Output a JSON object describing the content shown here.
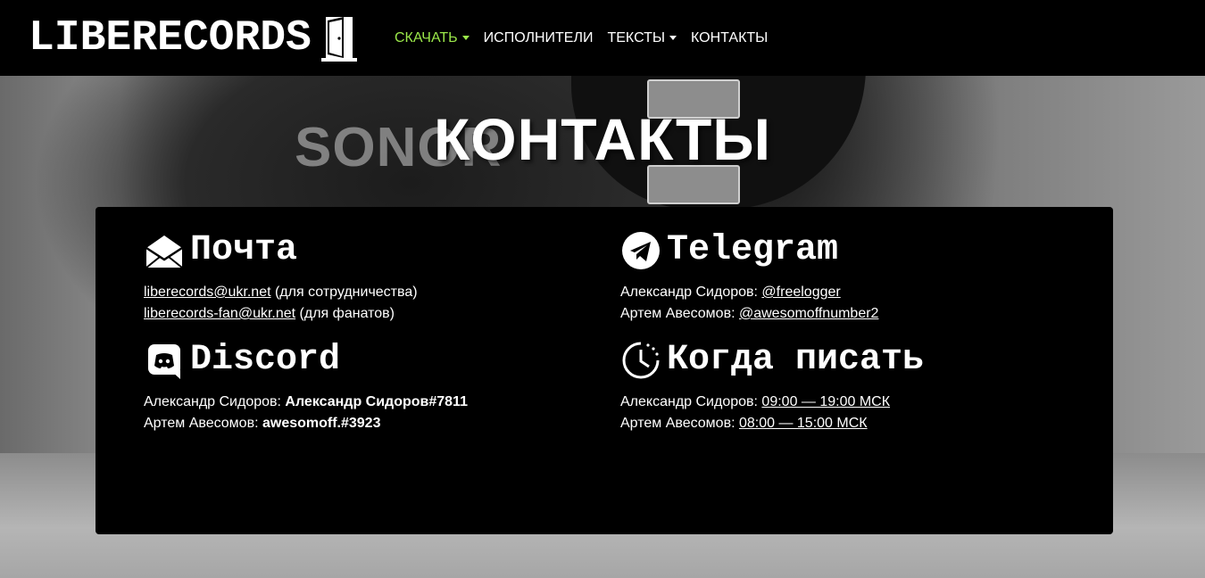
{
  "brand": {
    "logo_text": "LIBERECORDS"
  },
  "nav": {
    "items": [
      {
        "label": "СКАЧАТЬ",
        "active": true,
        "dropdown": true
      },
      {
        "label": "ИСПОЛНИТЕЛИ",
        "active": false,
        "dropdown": false
      },
      {
        "label": "ТЕКСТЫ",
        "active": false,
        "dropdown": true
      },
      {
        "label": "КОНТАКТЫ",
        "active": false,
        "dropdown": false
      }
    ]
  },
  "hero": {
    "title": "КОНТАКТЫ",
    "background_text": "SONOR"
  },
  "colors": {
    "accent": "#9be84a",
    "panel": "#000000",
    "text": "#ffffff"
  },
  "sections": {
    "mail": {
      "title": "Почта",
      "icon": "envelope-icon",
      "lines": [
        {
          "link": "liberecords@ukr.net",
          "suffix": " (для сотрудничества)"
        },
        {
          "link": "liberecords-fan@ukr.net",
          "suffix": " (для фанатов)"
        }
      ]
    },
    "telegram": {
      "title": "Telegram",
      "icon": "telegram-icon",
      "lines": [
        {
          "prefix": "Александр Сидоров: ",
          "link": "@freelogger"
        },
        {
          "prefix": "Артем Авесомов: ",
          "link": "@awesomoffnumber2"
        }
      ]
    },
    "discord": {
      "title": "Discord",
      "icon": "discord-icon",
      "lines": [
        {
          "prefix": "Александр Сидоров: ",
          "value": "Александр Сидоров#7811"
        },
        {
          "prefix": "Артем Авесомов: ",
          "value": "awesomoff.#3923"
        }
      ]
    },
    "when": {
      "title": "Когда писать",
      "icon": "clock-icon",
      "lines": [
        {
          "prefix": "Александр Сидоров: ",
          "link": "09:00 — 19:00 МСК"
        },
        {
          "prefix": "Артем Авесомов: ",
          "link": "08:00 — 15:00 МСК"
        }
      ]
    }
  }
}
